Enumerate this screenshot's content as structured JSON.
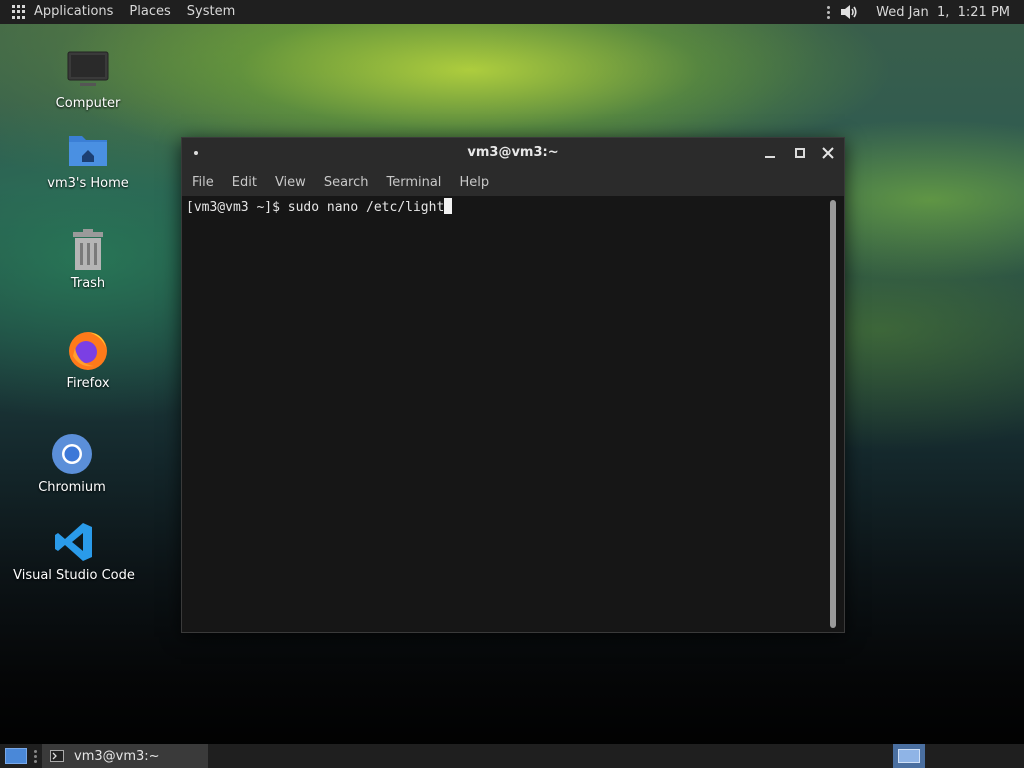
{
  "top_panel": {
    "menus": [
      "Applications",
      "Places",
      "System"
    ],
    "clock": "Wed Jan  1,  1:21 PM",
    "icons": [
      "apps-grid-icon",
      "more-vertical-icon",
      "volume-icon"
    ]
  },
  "desktop_icons": [
    {
      "label": "Computer",
      "icon": "computer-icon"
    },
    {
      "label": "vm3's Home",
      "icon": "home-folder-icon"
    },
    {
      "label": "Trash",
      "icon": "trash-icon"
    },
    {
      "label": "Firefox",
      "icon": "firefox-icon"
    },
    {
      "label": "Chromium",
      "icon": "chromium-icon"
    },
    {
      "label": "Visual Studio Code",
      "icon": "vscode-icon"
    }
  ],
  "terminal": {
    "title": "vm3@vm3:~",
    "menu": [
      "File",
      "Edit",
      "View",
      "Search",
      "Terminal",
      "Help"
    ],
    "prompt": "[vm3@vm3 ~]$ ",
    "command": "sudo nano /etc/light"
  },
  "bottom_panel": {
    "task_label": "vm3@vm3:~",
    "icons": [
      "show-desktop-icon",
      "terminal-icon",
      "workspace-switcher-icon"
    ]
  },
  "colors": {
    "panel_bg": "#1f1f1f",
    "terminal_bg": "#161616",
    "titlebar_bg": "#2b2b2b",
    "accent": "#4a88d8"
  }
}
